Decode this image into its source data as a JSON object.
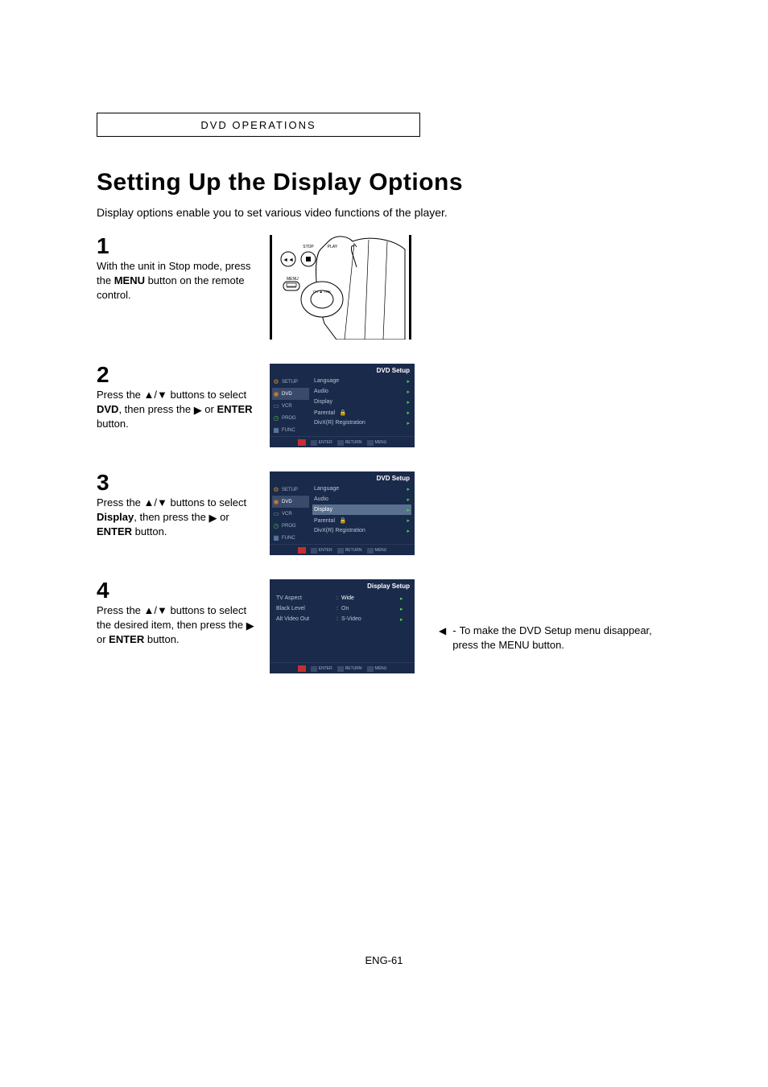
{
  "sectionTab": "DVD OPERATIONS",
  "title": "Setting Up the Display Options",
  "intro": "Display options enable you to set various video functions of the player.",
  "steps": {
    "s1": {
      "num": "1",
      "part1": "With the unit in Stop mode, press the ",
      "bold1": "MENU",
      "part2": " button on the remote control."
    },
    "s2": {
      "num": "2",
      "part1": "Press the ▲/▼ buttons to select ",
      "bold1": "DVD",
      "part2": ", then press the ",
      "ricon": "▶",
      "part3": " or ",
      "bold2": "ENTER",
      "part4": " button."
    },
    "s3": {
      "num": "3",
      "part1": "Press the ▲/▼ buttons to select ",
      "bold1": "Display",
      "part2": ", then press the ",
      "ricon": "▶",
      "part3": " or ",
      "bold2": "ENTER",
      "part4": " button."
    },
    "s4": {
      "num": "4",
      "part1": "Press the ▲/▼ buttons to select the desired item, then press the ",
      "ricon": "▶",
      "part2": " or ",
      "bold1": "ENTER",
      "part3": " button."
    }
  },
  "remote": {
    "stopLabel": "STOP",
    "playLabel": "PLAY",
    "menuLabel": "MENU",
    "chTrk": "CH ▲ TRK"
  },
  "osdDvd": {
    "title": "DVD Setup",
    "sidebar": [
      {
        "icon": "⚙",
        "label": "SETUP"
      },
      {
        "icon": "◉",
        "label": "DVD"
      },
      {
        "icon": "▭",
        "label": "VCR"
      },
      {
        "icon": "◷",
        "label": "PROG"
      },
      {
        "icon": "▦",
        "label": "FUNC"
      }
    ],
    "items": [
      {
        "label": "Language",
        "locked": false
      },
      {
        "label": "Audio",
        "locked": false
      },
      {
        "label": "Display",
        "locked": false
      },
      {
        "label": "Parental",
        "locked": true
      },
      {
        "label": "DivX(R) Registration",
        "locked": false
      }
    ],
    "footer": [
      "ENTER",
      "RETURN",
      "MENU"
    ]
  },
  "osdDisplay": {
    "title": "Display Setup",
    "items": [
      {
        "label": "TV Aspect",
        "value": "Wide"
      },
      {
        "label": "Black Level",
        "value": "On"
      },
      {
        "label": "Alt Video Out",
        "value": "S-Video"
      }
    ],
    "footer": [
      "ENTER",
      "RETURN",
      "MENU"
    ]
  },
  "sidenote": {
    "text": "To make the DVD Setup menu disappear, press the MENU button."
  },
  "pageFooter": "ENG-61"
}
